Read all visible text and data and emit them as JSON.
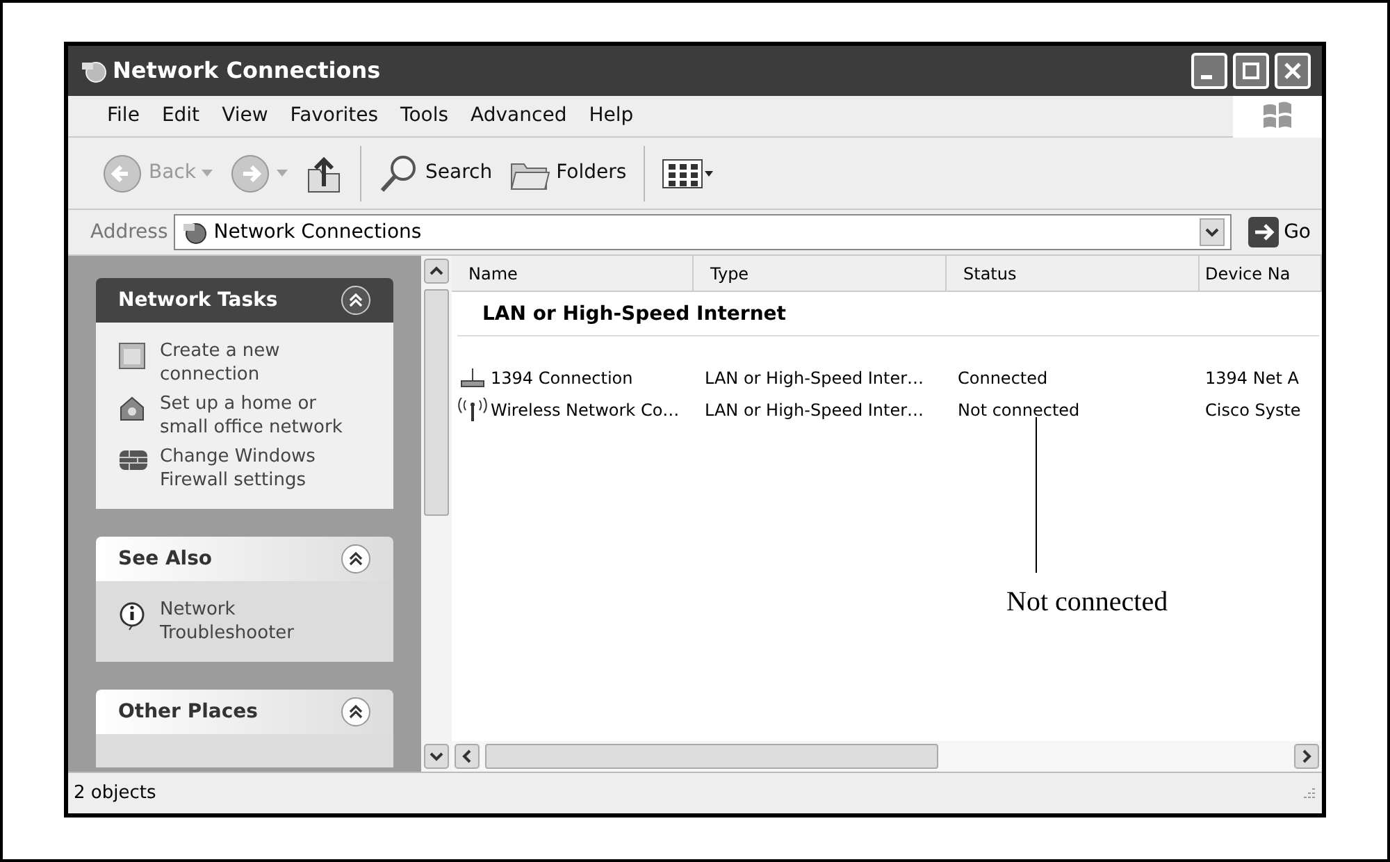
{
  "window": {
    "title": "Network Connections"
  },
  "menu": [
    "File",
    "Edit",
    "View",
    "Favorites",
    "Tools",
    "Advanced",
    "Help"
  ],
  "toolbar": [
    {
      "kind": "back",
      "label": "Back",
      "disabled": true
    },
    {
      "kind": "forward",
      "disabled": true
    },
    {
      "kind": "up"
    },
    {
      "kind": "search",
      "label": "Search"
    },
    {
      "kind": "folders",
      "label": "Folders"
    },
    {
      "kind": "views"
    }
  ],
  "address": {
    "label": "Address",
    "value": "Network Connections",
    "go": "Go"
  },
  "panels": [
    {
      "title": "Network Tasks",
      "kind": "dark",
      "items": [
        {
          "kind": "window",
          "label": "Create a new connection"
        },
        {
          "kind": "house",
          "label": "Set up a home or small office network"
        },
        {
          "kind": "firewall",
          "label": "Change Windows Firewall settings"
        }
      ]
    },
    {
      "title": "See Also",
      "kind": "light",
      "items": [
        {
          "kind": "info",
          "label": "Network Troubleshooter"
        }
      ]
    },
    {
      "title": "Other Places",
      "kind": "light"
    }
  ],
  "list": {
    "columns": [
      "Name",
      "Type",
      "Status",
      "Device Na"
    ],
    "group": "LAN or High-Speed Internet",
    "rows": [
      {
        "kind": "wired",
        "cells": [
          "1394 Connection",
          "LAN or High-Speed Inter…",
          "Connected",
          "1394 Net A"
        ]
      },
      {
        "kind": "wireless",
        "cells": [
          "Wireless Network Co…",
          "LAN or High-Speed Inter…",
          "Not connected",
          "Cisco Syste"
        ]
      }
    ]
  },
  "status_bar": "2 objects",
  "annotation": "Not connected"
}
